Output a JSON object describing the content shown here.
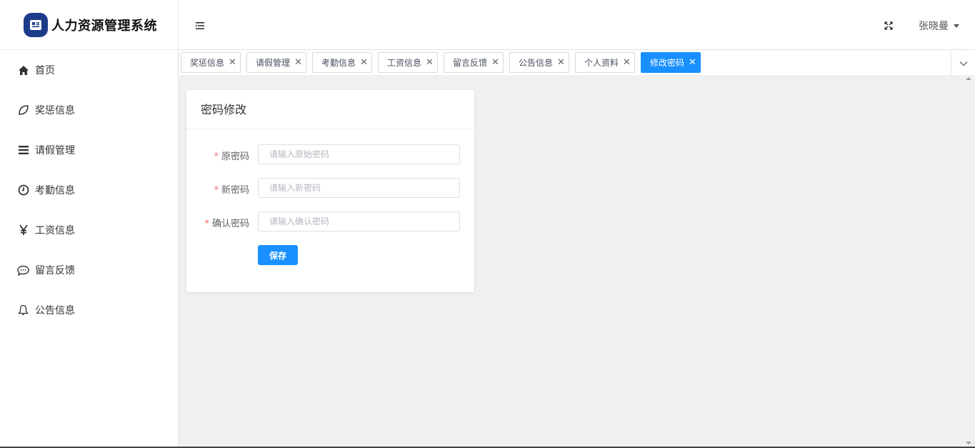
{
  "app": {
    "title": "人力资源管理系统"
  },
  "sidebar": {
    "items": [
      {
        "label": "首页",
        "icon": "home-icon"
      },
      {
        "label": "奖惩信息",
        "icon": "leaf-icon"
      },
      {
        "label": "请假管理",
        "icon": "list-icon"
      },
      {
        "label": "考勤信息",
        "icon": "clock-icon"
      },
      {
        "label": "工资信息",
        "icon": "yen-icon"
      },
      {
        "label": "留言反馈",
        "icon": "chat-icon"
      },
      {
        "label": "公告信息",
        "icon": "bell-icon"
      }
    ]
  },
  "header": {
    "user_name": "张晓曼"
  },
  "tabs": [
    {
      "label": "奖惩信息",
      "active": false
    },
    {
      "label": "请假管理",
      "active": false
    },
    {
      "label": "考勤信息",
      "active": false
    },
    {
      "label": "工资信息",
      "active": false
    },
    {
      "label": "留言反馈",
      "active": false
    },
    {
      "label": "公告信息",
      "active": false
    },
    {
      "label": "个人资料",
      "active": false
    },
    {
      "label": "修改密码",
      "active": true
    }
  ],
  "form": {
    "title": "密码修改",
    "fields": [
      {
        "label": "原密码",
        "placeholder": "请输入原始密码",
        "required": true
      },
      {
        "label": "新密码",
        "placeholder": "请输入新密码",
        "required": true
      },
      {
        "label": "确认密码",
        "placeholder": "请输入确认密码",
        "required": true
      }
    ],
    "required_mark": "*",
    "save_label": "保存"
  },
  "colors": {
    "accent": "#1890ff",
    "logo_bg": "#1e3c8c",
    "content_bg": "#f0f0f0"
  }
}
